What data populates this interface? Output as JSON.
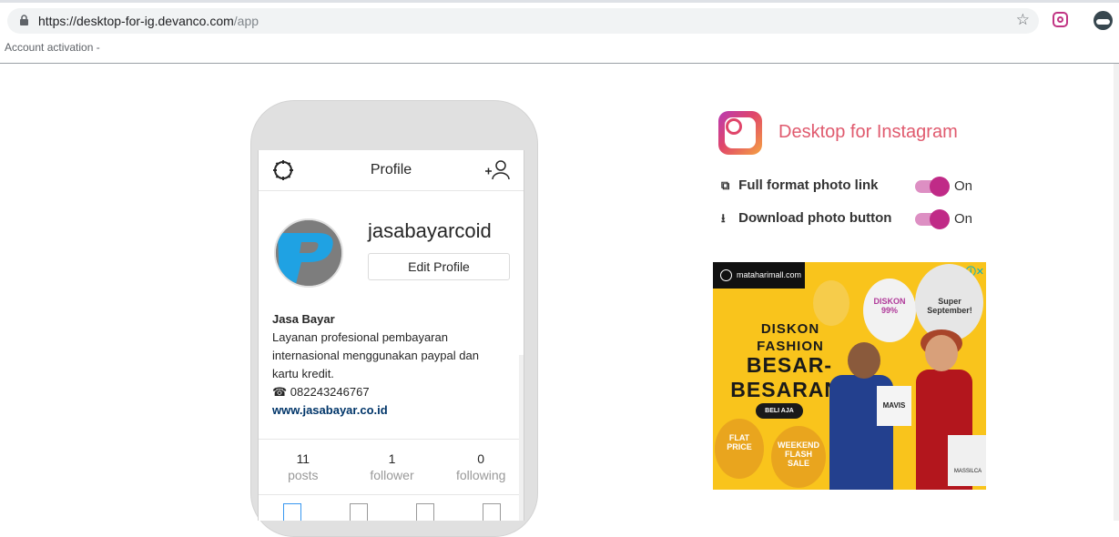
{
  "browser": {
    "url_host": "https://desktop-for-ig.devanco.com",
    "url_path": "/app",
    "bookmark": "Account activation -"
  },
  "profile": {
    "header_title": "Profile",
    "username": "jasabayarcoid",
    "edit_button": "Edit Profile",
    "full_name": "Jasa Bayar",
    "bio_line1": "Layanan profesional pembayaran",
    "bio_line2": "internasional menggunakan paypal dan",
    "bio_line3": "kartu kredit.",
    "phone": "☎ 082243246767",
    "website": "www.jasabayar.co.id",
    "stats": [
      {
        "value": "11",
        "label": "posts"
      },
      {
        "value": "1",
        "label": "follower"
      },
      {
        "value": "0",
        "label": "following"
      }
    ]
  },
  "extension": {
    "title": "Desktop for Instagram",
    "options": [
      {
        "label": "Full format photo link",
        "state": "On",
        "icon": "external-link-icon"
      },
      {
        "label": "Download photo button",
        "state": "On",
        "icon": "download-icon"
      }
    ],
    "toggle_color": "#c02a87"
  },
  "ad": {
    "brand": "mataharimall.com",
    "line1": "DISKON\nFASHION",
    "line2": "BESAR-\nBESARAN!",
    "cta": "BELI AJA",
    "balloon1": "DISKON\n99%",
    "balloon2": "Super\nSeptember!",
    "balloon3": "FLAT\nPRICE",
    "balloon4": "WEEKEND\nFLASH\nSALE",
    "bag1": "MAVIS",
    "bag2": "MASSILCA"
  }
}
